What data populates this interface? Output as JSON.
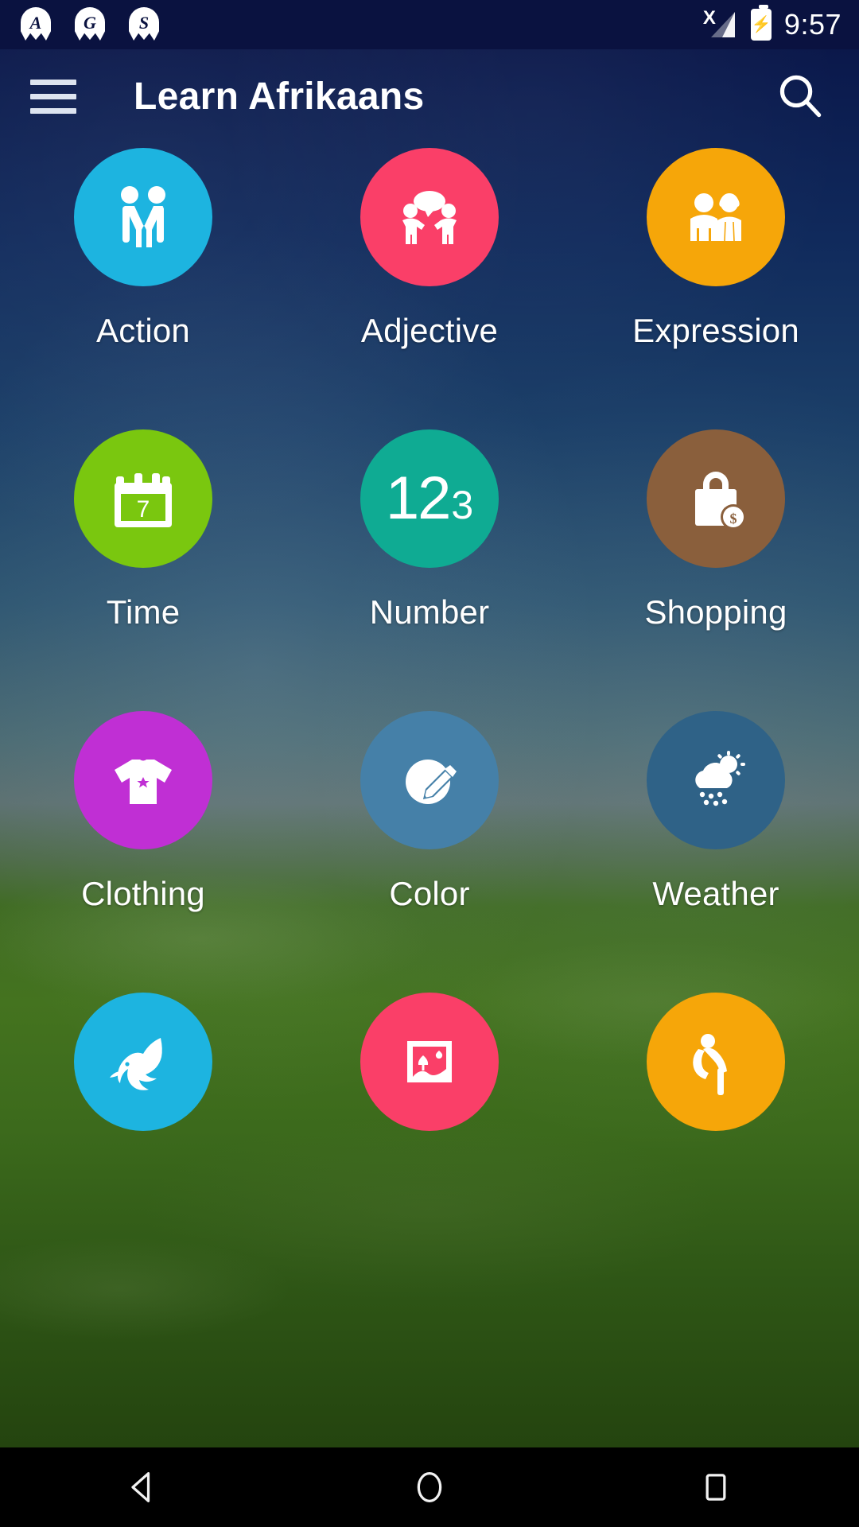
{
  "statusbar": {
    "notifications": [
      {
        "icon": "notification-badge-a-icon",
        "letter": "A"
      },
      {
        "icon": "notification-badge-g-icon",
        "letter": "G"
      },
      {
        "icon": "notification-badge-s-icon",
        "letter": "S"
      }
    ],
    "signal_icon": "signal-no-sim-icon",
    "signal_marker": "X",
    "battery_icon": "battery-charging-icon",
    "clock": "9:57"
  },
  "appbar": {
    "menu_icon": "hamburger-menu-icon",
    "title": "Learn Afrikaans",
    "search_icon": "search-icon"
  },
  "grid": {
    "items": [
      {
        "label": "Action",
        "color": "#1db4e0",
        "icon": "handshake-icon"
      },
      {
        "label": "Adjective",
        "color": "#fa3f68",
        "icon": "people-talking-icon"
      },
      {
        "label": "Expression",
        "color": "#f6a609",
        "icon": "couple-icon"
      },
      {
        "label": "Time",
        "color": "#7ac70f",
        "icon": "calendar-icon",
        "icon_text": "7"
      },
      {
        "label": "Number",
        "color": "#0fab93",
        "icon": "digits-123-icon",
        "digits_big": "12",
        "digits_small": "3"
      },
      {
        "label": "Shopping",
        "color": "#8a5f3c",
        "icon": "shopping-bag-dollar-icon"
      },
      {
        "label": "Clothing",
        "color": "#c02fd4",
        "icon": "tshirt-icon"
      },
      {
        "label": "Color",
        "color": "#4580a8",
        "icon": "palette-pencil-icon"
      },
      {
        "label": "Weather",
        "color": "#2f6287",
        "icon": "cloud-sun-rain-icon"
      },
      {
        "label": "",
        "color": "#1db4e0",
        "icon": "dolphin-icon"
      },
      {
        "label": "",
        "color": "#fa3f68",
        "icon": "landscape-picture-icon"
      },
      {
        "label": "",
        "color": "#f6a609",
        "icon": "person-bending-icon"
      }
    ]
  },
  "navbar": {
    "back_icon": "back-triangle-icon",
    "home_icon": "home-circle-icon",
    "recents_icon": "recents-square-icon"
  }
}
